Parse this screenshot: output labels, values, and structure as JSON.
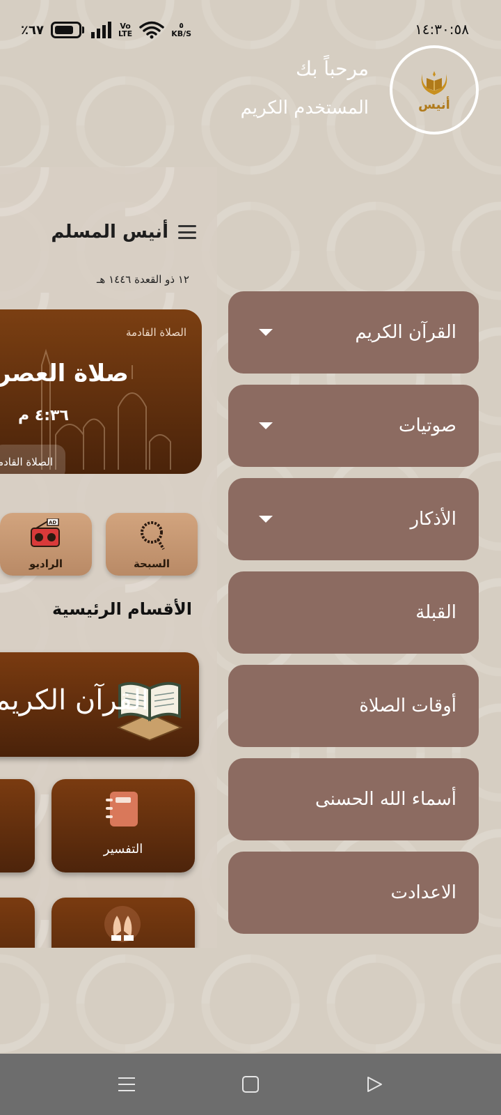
{
  "status_bar": {
    "battery_percent": "٪٦٧",
    "network": "VoLTE",
    "speed_value": "٥",
    "speed_unit": "KB/S",
    "time": "١٤:٣٠:٥٨"
  },
  "drawer": {
    "welcome": "مرحباً بك",
    "user_name": "المستخدم الكريم",
    "logo_text": "أنيس",
    "items": [
      {
        "label": "القرآن الكريم",
        "expandable": true
      },
      {
        "label": "صوتيات",
        "expandable": true
      },
      {
        "label": "الأذكار",
        "expandable": true
      },
      {
        "label": "القبلة",
        "expandable": false
      },
      {
        "label": "أوقات الصلاة",
        "expandable": false
      },
      {
        "label": "أسماء الله الحسنى",
        "expandable": false
      },
      {
        "label": "الاعدادت",
        "expandable": false
      }
    ]
  },
  "app": {
    "title": "أنيس المسلم",
    "hijri_date": "١٢ ذو القعدة ١٤٤٦ هـ",
    "next_prayer": {
      "label": "الصلاة القادمة",
      "name": "صلاة العصر",
      "time": "٤:٣٦ م",
      "button": "الصلاة القادمة"
    },
    "quick_actions": [
      {
        "label": "السبحة",
        "icon": "prayer-beads-icon"
      },
      {
        "label": "الراديو",
        "icon": "radio-icon"
      }
    ],
    "sections_title": "الأقسام الرئيسية",
    "quran_banner": "القرآن الكريم",
    "tiles": [
      {
        "label": "التفسير",
        "icon": "notebook-icon"
      },
      {
        "label": "",
        "icon": "praying-hands-icon"
      }
    ]
  },
  "colors": {
    "drawer_item_bg": "#8c6b61",
    "card_brown": "#7a3b10",
    "tile_tan": "#d2a47e",
    "nav_bar": "#6d6d6d"
  }
}
